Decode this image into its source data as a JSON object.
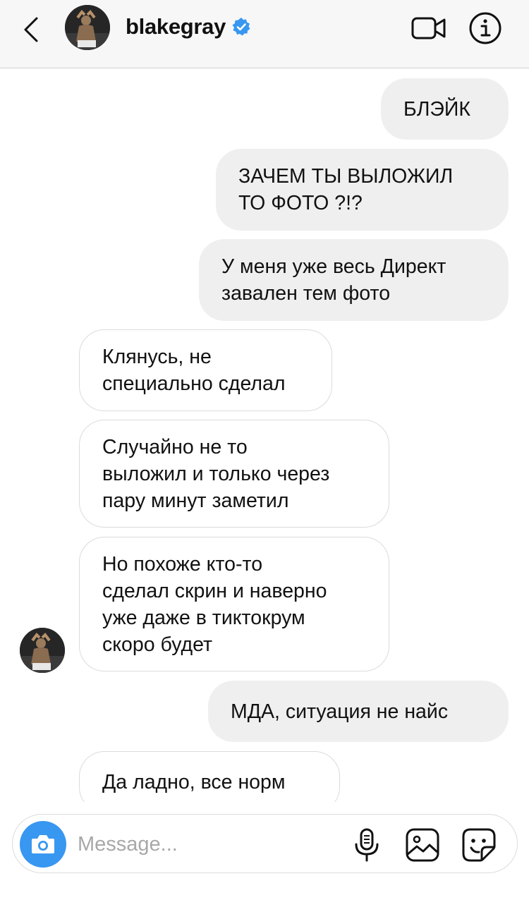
{
  "header": {
    "username": "blakegray",
    "verified": true,
    "icons": [
      "chevron-left-icon",
      "avatar",
      "verified-badge-icon",
      "video-camera-icon",
      "info-icon"
    ]
  },
  "messages": [
    {
      "dir": "outgoing",
      "text": "БЛЭЙК"
    },
    {
      "dir": "outgoing",
      "text": "ЗАЧЕМ ТЫ ВЫЛОЖИЛ\nТО ФОТО ?!?"
    },
    {
      "dir": "outgoing",
      "text": "У меня уже весь Директ\nзавален тем фото"
    },
    {
      "dir": "incoming",
      "text": "Клянусь, не\nспециально сделал"
    },
    {
      "dir": "incoming",
      "text": "Случайно не то\nвыложил и только через\nпару минут заметил"
    },
    {
      "dir": "incoming",
      "text": "Но похоже кто-то\nсделал скрин и наверно\nуже даже в тиктокрум\nскоро будет"
    },
    {
      "dir": "outgoing",
      "text": "МДА, ситуация не найс"
    },
    {
      "dir": "incoming",
      "text": "Да ладно, все норм"
    }
  ],
  "composer": {
    "placeholder": "Message...",
    "value": "",
    "icons": [
      "camera-icon",
      "microphone-icon",
      "gallery-icon",
      "sticker-icon"
    ]
  },
  "colors": {
    "accent": "#3897f0",
    "outgoing_bubble": "#efefef",
    "incoming_border": "#dbdbdb",
    "header_bg": "#f7f7f7"
  }
}
